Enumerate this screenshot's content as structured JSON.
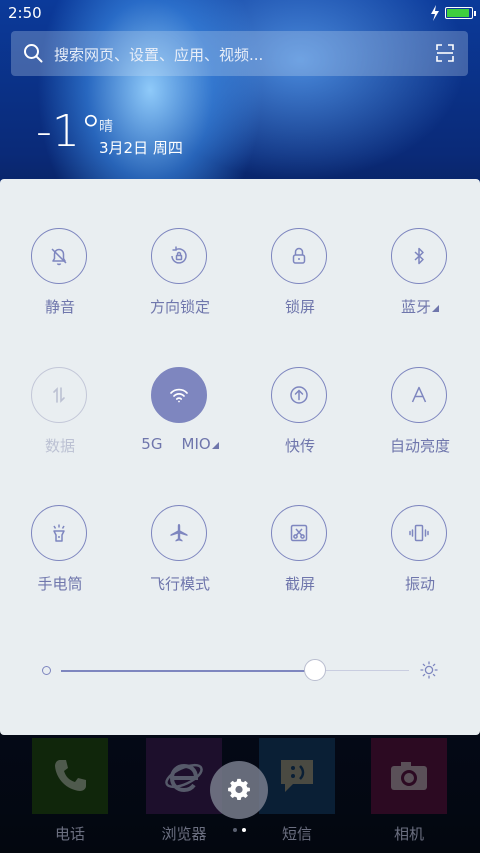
{
  "status_bar": {
    "time": "2:50",
    "battery_level": 0.95,
    "charging": true,
    "battery_color": "#3ecf3e"
  },
  "search": {
    "placeholder": "搜索网页、设置、应用、视频...",
    "icon": "search-icon",
    "scan_icon": "scan-icon"
  },
  "weather": {
    "temperature": "-1°",
    "condition": "晴",
    "date": "3月2日 周四"
  },
  "quick_settings": {
    "tiles": [
      {
        "id": "mute",
        "label": "静音",
        "icon": "bell-off-icon",
        "state": "off"
      },
      {
        "id": "rotation",
        "label": "方向锁定",
        "icon": "rotation-lock-icon",
        "state": "off"
      },
      {
        "id": "lock",
        "label": "锁屏",
        "icon": "lock-icon",
        "state": "off"
      },
      {
        "id": "bluetooth",
        "label": "蓝牙",
        "icon": "bluetooth-icon",
        "state": "off",
        "has_menu": true
      },
      {
        "id": "data",
        "label": "数据",
        "icon": "data-transfer-icon",
        "state": "disabled"
      },
      {
        "id": "wifi",
        "label": "5G    MIO",
        "icon": "wifi-icon",
        "state": "on",
        "has_menu": true
      },
      {
        "id": "share",
        "label": "快传",
        "icon": "upload-icon",
        "state": "off"
      },
      {
        "id": "auto_brightness",
        "label": "自动亮度",
        "icon": "auto-brightness-icon",
        "state": "off"
      },
      {
        "id": "flashlight",
        "label": "手电筒",
        "icon": "flashlight-icon",
        "state": "off"
      },
      {
        "id": "airplane",
        "label": "飞行模式",
        "icon": "airplane-icon",
        "state": "off"
      },
      {
        "id": "screenshot",
        "label": "截屏",
        "icon": "scissors-icon",
        "state": "off"
      },
      {
        "id": "vibrate",
        "label": "振动",
        "icon": "vibrate-icon",
        "state": "off"
      }
    ],
    "brightness": 0.73,
    "accent_color": "#7e86bf"
  },
  "dock": {
    "apps": [
      {
        "label": "电话",
        "icon": "phone-icon",
        "color": "#1a3a10"
      },
      {
        "label": "浏览器",
        "icon": "browser-icon",
        "color": "#221035"
      },
      {
        "label": "短信",
        "icon": "message-icon",
        "color": "#0a2a48"
      },
      {
        "label": "相机",
        "icon": "camera-icon",
        "color": "#3a0a2a"
      }
    ],
    "settings_icon": "gear-icon",
    "pager": {
      "pages": 2,
      "current": 2
    }
  }
}
